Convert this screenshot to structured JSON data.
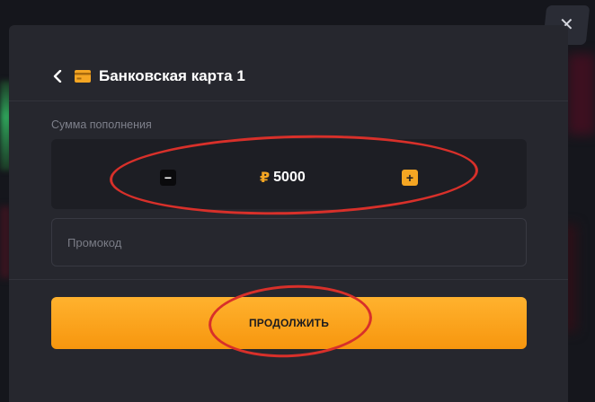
{
  "header": {
    "title": "Банковская карта 1",
    "back_icon": "chevron-left-icon",
    "card_icon": "credit-card-icon"
  },
  "close_icon": "close-icon",
  "amount": {
    "label": "Сумма пополнения",
    "currency_symbol": "₽",
    "value": "5000",
    "minus_label": "−",
    "plus_label": "+"
  },
  "promo": {
    "placeholder": "Промокод",
    "value": ""
  },
  "continue_button": {
    "label": "ПРОДОЛЖИТЬ"
  },
  "colors": {
    "accent": "#f5a623",
    "modal_bg": "#26272e",
    "input_bg": "#1d1e24",
    "annotation": "#d8302a"
  }
}
